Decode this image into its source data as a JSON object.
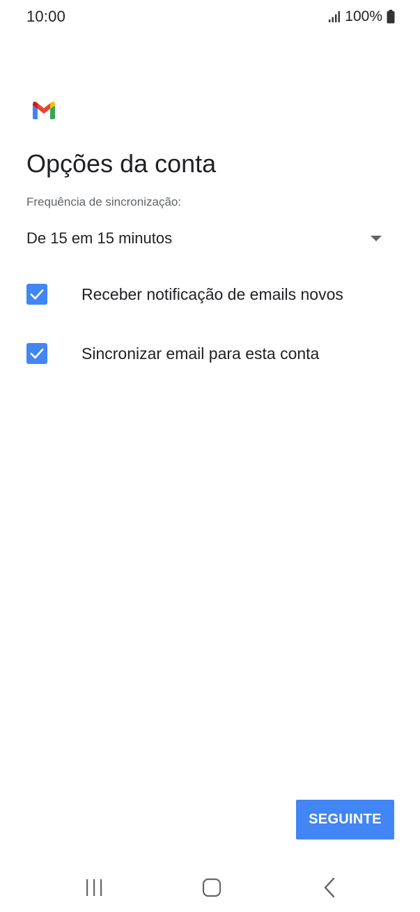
{
  "status_bar": {
    "time": "10:00",
    "battery": "100%",
    "icons": [
      "signal-icon",
      "battery-icon"
    ]
  },
  "app": {
    "logo": "gmail-logo-icon",
    "colors": {
      "accent": "#4285f4",
      "gmail_red": "#ea4335",
      "gmail_blue": "#4285f4",
      "gmail_green": "#34a853",
      "gmail_yellow": "#fbbc04"
    }
  },
  "main": {
    "title": "Opções da conta",
    "sync_frequency_label": "Frequência de sincronização:",
    "sync_frequency_value": "De 15 em 15 minutos",
    "options": [
      {
        "label": "Receber notificação de emails novos",
        "checked": true
      },
      {
        "label": "Sincronizar email para esta conta",
        "checked": true
      }
    ],
    "next_label": "SEGUINTE"
  },
  "nav_bar": {
    "icons": [
      "recents-icon",
      "home-icon",
      "back-icon"
    ]
  }
}
